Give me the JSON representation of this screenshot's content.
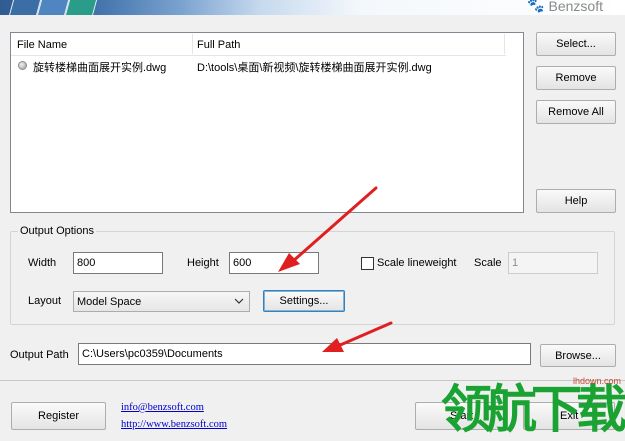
{
  "brand": "Benzsoft",
  "file_list": {
    "columns": [
      "File Name",
      "Full Path"
    ],
    "rows": [
      {
        "name": "旋转楼梯曲面展开实例.dwg",
        "path": "D:\\tools\\桌面\\新视频\\旋转楼梯曲面展开实例.dwg"
      }
    ]
  },
  "side_buttons": {
    "select": "Select...",
    "remove": "Remove",
    "remove_all": "Remove All",
    "help": "Help"
  },
  "output_options": {
    "title": "Output Options",
    "width_label": "Width",
    "width_value": "800",
    "height_label": "Height",
    "height_value": "600",
    "scale_lineweight_label": "Scale lineweight",
    "scale_lineweight_checked": false,
    "scale_label": "Scale",
    "scale_value": "1",
    "layout_label": "Layout",
    "layout_value": "Model Space",
    "settings_button": "Settings..."
  },
  "output_path": {
    "label": "Output Path",
    "value": "C:\\Users\\pc0359\\Documents",
    "browse_button": "Browse..."
  },
  "footer": {
    "register_button": "Register",
    "email_link": "info@benzsoft.com",
    "web_link": "http://www.benzsoft.com",
    "start_button": "Start",
    "exit_button": "Exit"
  },
  "watermark": {
    "text": "领航下载",
    "site": "lhdown.com"
  },
  "colors": {
    "annotation_arrow": "#e02020",
    "watermark": "#1aa332",
    "link": "#0000cc",
    "focus_border": "#3c7fb1"
  }
}
